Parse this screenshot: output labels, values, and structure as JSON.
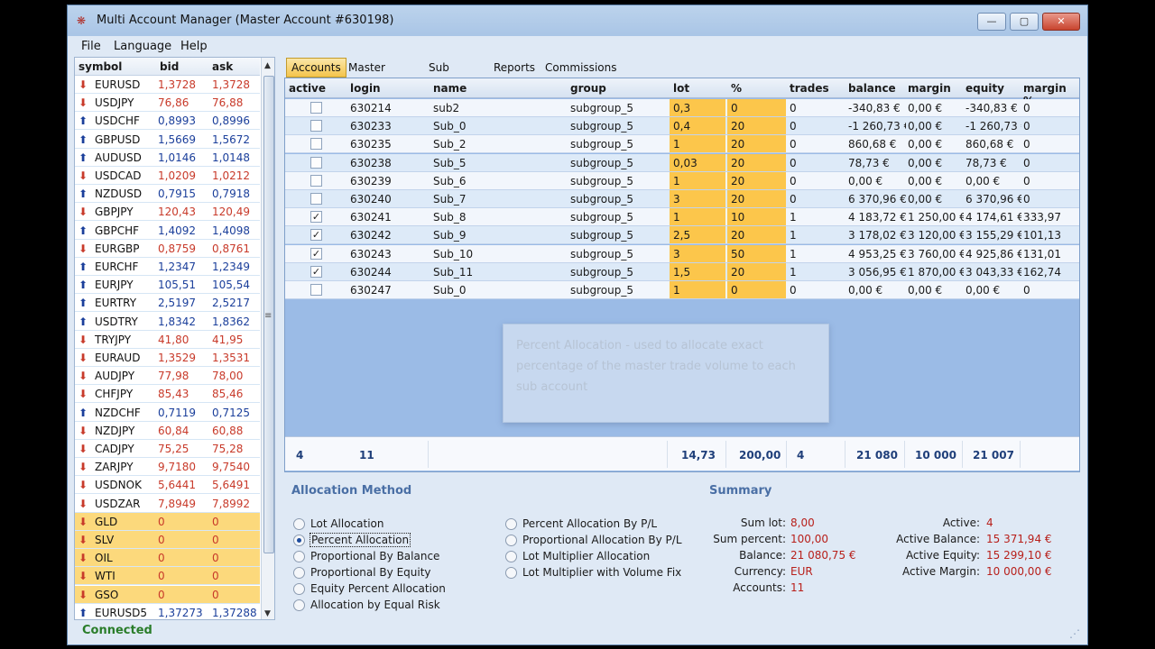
{
  "window": {
    "title": "Multi Account Manager (Master Account #630198)",
    "minimize": "—",
    "maximize": "▢",
    "close": "✕"
  },
  "menu": [
    {
      "label": "File"
    },
    {
      "label": "Language"
    },
    {
      "label": "Help"
    }
  ],
  "symbols": {
    "headers": [
      "symbol",
      "bid",
      "ask"
    ],
    "rows": [
      {
        "symbol": "EURUSD",
        "bid": "1,3728",
        "ask": "1,3728",
        "dir": "down",
        "metal": false
      },
      {
        "symbol": "USDJPY",
        "bid": "76,86",
        "ask": "76,88",
        "dir": "down",
        "metal": false
      },
      {
        "symbol": "USDCHF",
        "bid": "0,8993",
        "ask": "0,8996",
        "dir": "up",
        "metal": false
      },
      {
        "symbol": "GBPUSD",
        "bid": "1,5669",
        "ask": "1,5672",
        "dir": "up",
        "metal": false
      },
      {
        "symbol": "AUDUSD",
        "bid": "1,0146",
        "ask": "1,0148",
        "dir": "up",
        "metal": false
      },
      {
        "symbol": "USDCAD",
        "bid": "1,0209",
        "ask": "1,0212",
        "dir": "down",
        "metal": false
      },
      {
        "symbol": "NZDUSD",
        "bid": "0,7915",
        "ask": "0,7918",
        "dir": "up",
        "metal": false
      },
      {
        "symbol": "GBPJPY",
        "bid": "120,43",
        "ask": "120,49",
        "dir": "down",
        "metal": false
      },
      {
        "symbol": "GBPCHF",
        "bid": "1,4092",
        "ask": "1,4098",
        "dir": "up",
        "metal": false
      },
      {
        "symbol": "EURGBP",
        "bid": "0,8759",
        "ask": "0,8761",
        "dir": "down",
        "metal": false
      },
      {
        "symbol": "EURCHF",
        "bid": "1,2347",
        "ask": "1,2349",
        "dir": "up",
        "metal": false
      },
      {
        "symbol": "EURJPY",
        "bid": "105,51",
        "ask": "105,54",
        "dir": "up",
        "metal": false
      },
      {
        "symbol": "EURTRY",
        "bid": "2,5197",
        "ask": "2,5217",
        "dir": "up",
        "metal": false
      },
      {
        "symbol": "USDTRY",
        "bid": "1,8342",
        "ask": "1,8362",
        "dir": "up",
        "metal": false
      },
      {
        "symbol": "TRYJPY",
        "bid": "41,80",
        "ask": "41,95",
        "dir": "down",
        "metal": false
      },
      {
        "symbol": "EURAUD",
        "bid": "1,3529",
        "ask": "1,3531",
        "dir": "down",
        "metal": false
      },
      {
        "symbol": "AUDJPY",
        "bid": "77,98",
        "ask": "78,00",
        "dir": "down",
        "metal": false
      },
      {
        "symbol": "CHFJPY",
        "bid": "85,43",
        "ask": "85,46",
        "dir": "down",
        "metal": false
      },
      {
        "symbol": "NZDCHF",
        "bid": "0,7119",
        "ask": "0,7125",
        "dir": "up",
        "metal": false
      },
      {
        "symbol": "NZDJPY",
        "bid": "60,84",
        "ask": "60,88",
        "dir": "down",
        "metal": false
      },
      {
        "symbol": "CADJPY",
        "bid": "75,25",
        "ask": "75,28",
        "dir": "down",
        "metal": false
      },
      {
        "symbol": "ZARJPY",
        "bid": "9,7180",
        "ask": "9,7540",
        "dir": "down",
        "metal": false
      },
      {
        "symbol": "USDNOK",
        "bid": "5,6441",
        "ask": "5,6491",
        "dir": "down",
        "metal": false
      },
      {
        "symbol": "USDZAR",
        "bid": "7,8949",
        "ask": "7,8992",
        "dir": "down",
        "metal": false
      },
      {
        "symbol": "GLD",
        "bid": "0",
        "ask": "0",
        "dir": "down",
        "metal": true
      },
      {
        "symbol": "SLV",
        "bid": "0",
        "ask": "0",
        "dir": "down",
        "metal": true
      },
      {
        "symbol": "OIL",
        "bid": "0",
        "ask": "0",
        "dir": "down",
        "metal": true
      },
      {
        "symbol": "WTI",
        "bid": "0",
        "ask": "0",
        "dir": "down",
        "metal": true
      },
      {
        "symbol": "GSO",
        "bid": "0",
        "ask": "0",
        "dir": "down",
        "metal": true
      },
      {
        "symbol": "EURUSD5",
        "bid": "1,37273",
        "ask": "1,37288",
        "dir": "up",
        "metal": false
      }
    ]
  },
  "status": "Connected",
  "tabs": [
    {
      "label": "Accounts",
      "active": true
    },
    {
      "label": "Master Orders",
      "active": false
    },
    {
      "label": "Sub Orders",
      "active": false
    },
    {
      "label": "Reports",
      "active": false
    },
    {
      "label": "Commissions",
      "active": false
    }
  ],
  "accounts": {
    "headers": [
      "active",
      "login",
      "name",
      "group",
      "lot",
      "%",
      "trades",
      "balance",
      "margin",
      "equity",
      "margin %"
    ],
    "rows": [
      {
        "active": false,
        "login": "630214",
        "name": "sub2",
        "group": "subgroup_5",
        "lot": "0,3",
        "pct": "0",
        "trades": "0",
        "balance": "-340,83 €",
        "margin": "0,00 €",
        "equity": "-340,83 €",
        "margin_pct": "0"
      },
      {
        "active": false,
        "login": "630233",
        "name": "Sub_0",
        "group": "subgroup_5",
        "lot": "0,4",
        "pct": "20",
        "trades": "0",
        "balance": "-1 260,73 €",
        "margin": "0,00 €",
        "equity": "-1 260,73 €",
        "margin_pct": "0"
      },
      {
        "active": false,
        "login": "630235",
        "name": "Sub_2",
        "group": "subgroup_5",
        "lot": "1",
        "pct": "20",
        "trades": "0",
        "balance": "860,68 €",
        "margin": "0,00 €",
        "equity": "860,68 €",
        "margin_pct": "0"
      },
      {
        "active": false,
        "login": "630238",
        "name": "Sub_5",
        "group": "subgroup_5",
        "lot": "0,03",
        "pct": "20",
        "trades": "0",
        "balance": "78,73 €",
        "margin": "0,00 €",
        "equity": "78,73 €",
        "margin_pct": "0"
      },
      {
        "active": false,
        "login": "630239",
        "name": "Sub_6",
        "group": "subgroup_5",
        "lot": "1",
        "pct": "20",
        "trades": "0",
        "balance": "0,00 €",
        "margin": "0,00 €",
        "equity": "0,00 €",
        "margin_pct": "0"
      },
      {
        "active": false,
        "login": "630240",
        "name": "Sub_7",
        "group": "subgroup_5",
        "lot": "3",
        "pct": "20",
        "trades": "0",
        "balance": "6 370,96 €",
        "margin": "0,00 €",
        "equity": "6 370,96 €",
        "margin_pct": "0"
      },
      {
        "active": true,
        "login": "630241",
        "name": "Sub_8",
        "group": "subgroup_5",
        "lot": "1",
        "pct": "10",
        "trades": "1",
        "balance": "4 183,72 €",
        "margin": "1 250,00 €",
        "equity": "4 174,61 €",
        "margin_pct": "333,97"
      },
      {
        "active": true,
        "login": "630242",
        "name": "Sub_9",
        "group": "subgroup_5",
        "lot": "2,5",
        "pct": "20",
        "trades": "1",
        "balance": "3 178,02 €",
        "margin": "3 120,00 €",
        "equity": "3 155,29 €",
        "margin_pct": "101,13"
      },
      {
        "active": true,
        "login": "630243",
        "name": "Sub_10",
        "group": "subgroup_5",
        "lot": "3",
        "pct": "50",
        "trades": "1",
        "balance": "4 953,25 €",
        "margin": "3 760,00 €",
        "equity": "4 925,86 €",
        "margin_pct": "131,01"
      },
      {
        "active": true,
        "login": "630244",
        "name": "Sub_11",
        "group": "subgroup_5",
        "lot": "1,5",
        "pct": "20",
        "trades": "1",
        "balance": "3 056,95 €",
        "margin": "1 870,00 €",
        "equity": "3 043,33 €",
        "margin_pct": "162,74"
      },
      {
        "active": false,
        "login": "630247",
        "name": "Sub_0",
        "group": "subgroup_5",
        "lot": "1",
        "pct": "0",
        "trades": "0",
        "balance": "0,00 €",
        "margin": "0,00 €",
        "equity": "0,00 €",
        "margin_pct": "0"
      }
    ],
    "totals": {
      "active": "4",
      "login": "11",
      "lot": "14,73",
      "pct": "200,00",
      "trades": "4",
      "balance": "21 080",
      "margin": "10 000",
      "equity": "21 007"
    }
  },
  "tooltip": "Percent Allocation - used to allocate exact percentage of the master trade volume to each sub account",
  "allocation": {
    "title": "Allocation Method",
    "left": [
      {
        "label": "Lot Allocation",
        "selected": false
      },
      {
        "label": "Percent Allocation",
        "selected": true
      },
      {
        "label": "Proportional By Balance",
        "selected": false
      },
      {
        "label": "Proportional By Equity",
        "selected": false
      },
      {
        "label": "Equity Percent Allocation",
        "selected": false
      },
      {
        "label": "Allocation by Equal Risk",
        "selected": false
      }
    ],
    "right": [
      {
        "label": "Percent Allocation By P/L",
        "selected": false
      },
      {
        "label": "Proportional Allocation By P/L",
        "selected": false
      },
      {
        "label": "Lot Multiplier Allocation",
        "selected": false
      },
      {
        "label": "Lot Multiplier with Volume Fix",
        "selected": false
      }
    ]
  },
  "summary": {
    "title": "Summary",
    "left": [
      {
        "label": "Sum lot:",
        "value": "8,00"
      },
      {
        "label": "Sum percent:",
        "value": "100,00"
      },
      {
        "label": "Balance:",
        "value": "21 080,75 €"
      },
      {
        "label": "Currency:",
        "value": "EUR"
      },
      {
        "label": "Accounts:",
        "value": "11"
      }
    ],
    "right": [
      {
        "label": "Active:",
        "value": "4"
      },
      {
        "label": "Active Balance:",
        "value": "15 371,94 €"
      },
      {
        "label": "Active Equity:",
        "value": "15 299,10 €"
      },
      {
        "label": "Active Margin:",
        "value": "10 000,00 €"
      }
    ]
  }
}
